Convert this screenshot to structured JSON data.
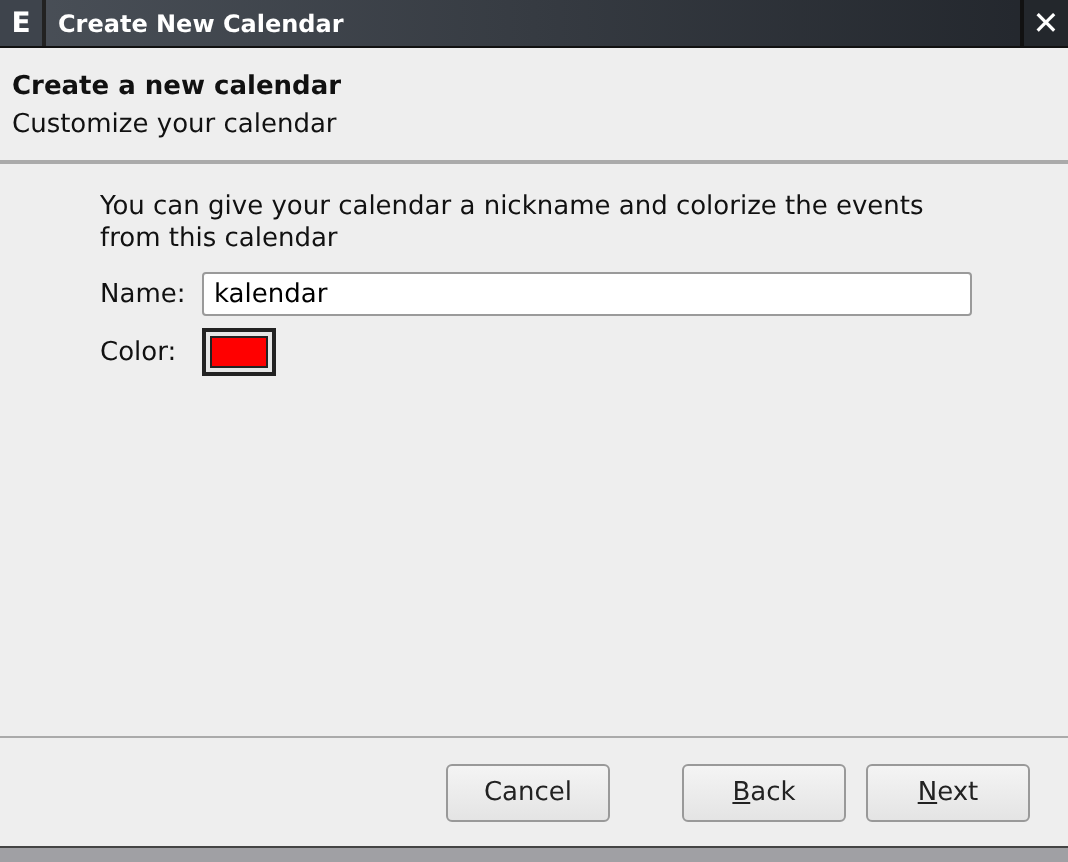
{
  "window": {
    "menu_button": "E",
    "title": "Create New Calendar",
    "close": "✕"
  },
  "header": {
    "title": "Create a new calendar",
    "subtitle": "Customize your calendar"
  },
  "description": "You can give your calendar a nickname and colorize the events from this calendar",
  "name_field": {
    "label": "Name:",
    "value": "kalendar"
  },
  "color_field": {
    "label": "Color:",
    "color": "#ff0000"
  },
  "buttons": [
    {
      "label": "Cancel",
      "mnemonic_underlined": false
    },
    {
      "label": "Back",
      "mnemonic_underlined": true
    },
    {
      "label": "Next",
      "mnemonic_underlined": true
    }
  ]
}
